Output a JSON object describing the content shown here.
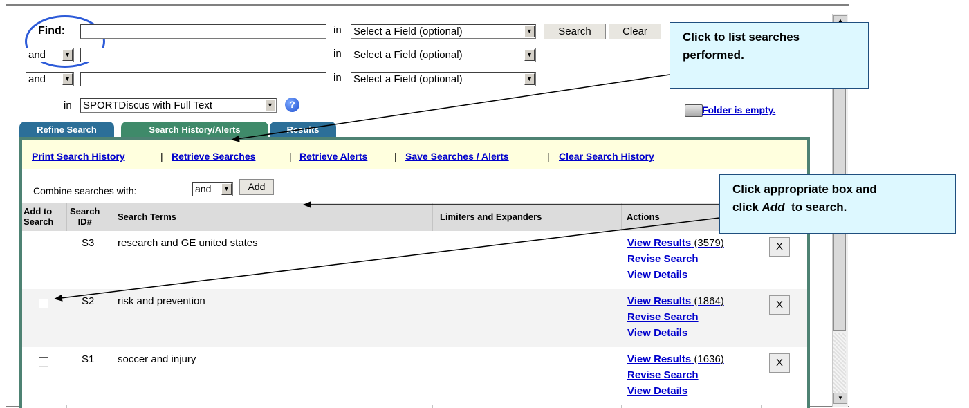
{
  "find": {
    "label": "Find:",
    "rows": [
      {
        "operator": "",
        "value": "",
        "in_label": "in",
        "field_select": "Select a Field (optional)"
      },
      {
        "operator": "and",
        "value": "",
        "in_label": "in",
        "field_select": "Select a Field (optional)"
      },
      {
        "operator": "and",
        "value": "",
        "in_label": "in",
        "field_select": "Select a Field (optional)"
      }
    ],
    "search_button": "Search",
    "clear_button": "Clear",
    "database_in_label": "in",
    "database": "SPORTDiscus with Full Text",
    "help_icon": "?"
  },
  "folder": {
    "icon": "folder-icon",
    "label": "Folder is empty."
  },
  "tabs": [
    {
      "label": "Refine Search",
      "color": "#2c6f98"
    },
    {
      "label": "Search History/Alerts",
      "color": "#3f8a6a",
      "active": true
    },
    {
      "label": "Results",
      "color": "#2c6f98"
    }
  ],
  "history_links": [
    "Print Search History",
    "Retrieve Searches",
    "Retrieve Alerts",
    "Save Searches / Alerts",
    "Clear Search History"
  ],
  "history_separator": "|",
  "combine": {
    "label": "Combine searches with:",
    "operator": "and",
    "add_button": "Add"
  },
  "table": {
    "headers": {
      "add_to_search": [
        "Add to",
        "Search"
      ],
      "search_id": [
        "Search",
        "ID#"
      ],
      "terms": "Search Terms",
      "limiters": "Limiters and Expanders",
      "actions": "Actions"
    },
    "rows": [
      {
        "id": "S3",
        "terms": "research and GE united states",
        "limiters": "",
        "view_results": "View Results",
        "count": "(3579)",
        "revise": "Revise Search",
        "details": "View Details",
        "delete": "X"
      },
      {
        "id": "S2",
        "terms": "risk and prevention",
        "limiters": "",
        "view_results": "View Results",
        "count": "(1864)",
        "revise": "Revise Search",
        "details": "View Details",
        "delete": "X"
      },
      {
        "id": "S1",
        "terms": "soccer and injury",
        "limiters": "",
        "view_results": "View Results",
        "count": "(1636)",
        "revise": "Revise Search",
        "details": "View Details",
        "delete": "X"
      }
    ]
  },
  "callouts": {
    "top": [
      "Click to list searches",
      "performed."
    ],
    "bottom": {
      "line1": "Click appropriate box and",
      "line2_pre": "click ",
      "line2_em": "Add",
      "line2_post": "  to search."
    }
  },
  "colors": {
    "link": "#0000cc",
    "panel_border": "#4e8273",
    "linkbar_bg": "#ffffde",
    "callout_bg": "#ddf8ff",
    "circle": "#2d5bd8"
  }
}
